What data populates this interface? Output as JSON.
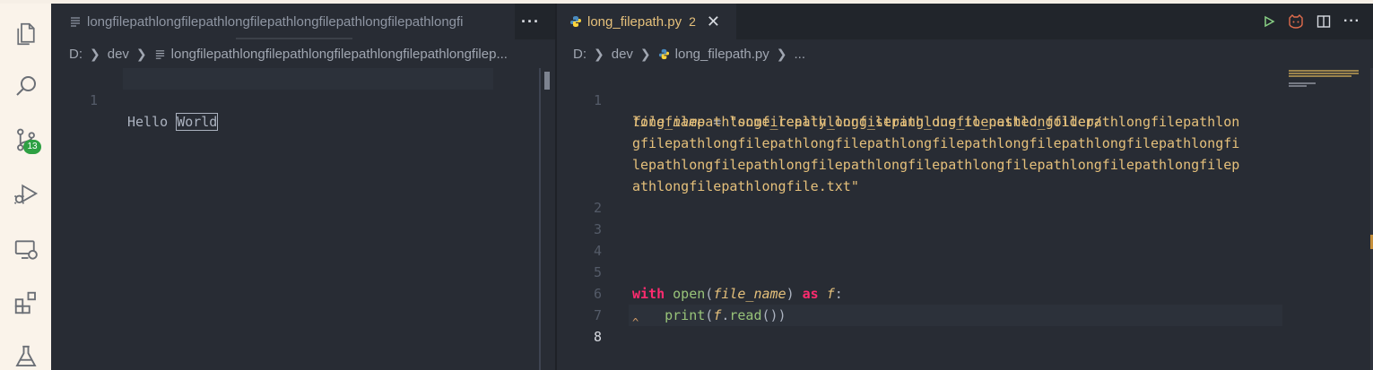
{
  "activity_bar": {
    "items": [
      {
        "name": "explorer-icon"
      },
      {
        "name": "search-icon"
      },
      {
        "name": "source-control-icon",
        "badge": "13"
      },
      {
        "name": "run-debug-icon"
      },
      {
        "name": "remote-explorer-icon"
      },
      {
        "name": "extensions-icon"
      },
      {
        "name": "testing-icon"
      }
    ]
  },
  "left_editor": {
    "tab": {
      "label": "longfilepathlongfilepathlongfilepathlongfilepathlongfilepathlongfi"
    },
    "more_label": "···",
    "breadcrumb": {
      "drive": "D:",
      "folder": "dev",
      "file": "longfilepathlongfilepathlongfilepathlongfilepathlongfilep..."
    },
    "lines": [
      {
        "number": "1",
        "before": "Hello ",
        "highlight": "World"
      }
    ]
  },
  "right_editor": {
    "tab": {
      "label": "long_filepath.py",
      "dirty_count": "2",
      "close_label": "✕"
    },
    "breadcrumb": {
      "drive": "D:",
      "folder": "dev",
      "file": "long_filepath.py",
      "more": "..."
    },
    "actions": [
      "run-icon",
      "copilot-icon",
      "split-editor-icon",
      "more-actions-icon"
    ],
    "more_label": "···",
    "code": {
      "l1_var": "file_name",
      "l1_eq": " = ",
      "l1_str_1": "\"some_really_long_string_due_to_nested_folder/",
      "l1_str_2": "longfilepathlongfilepathlongfilepathlongfilepathlongfilepathlongfilepathlon",
      "l1_str_3": "gfilepathlongfilepathlongfilepathlongfilepathlongfilepathlongfilepathlongfi",
      "l1_str_4": "lepathlongfilepathlongfilepathlongfilepathlongfilepathlongfilepathlongfilep",
      "l1_str_5": "athlongfilepathlongfile.txt\"",
      "l5_with": "with",
      "l5_open": "open",
      "l5_lp": "(",
      "l5_arg": "file_name",
      "l5_rp": ") ",
      "l5_as": "as",
      "l5_f": "f",
      "l5_colon": ":",
      "l6_indent": "    ",
      "l6_print": "print",
      "l6_lp": "(",
      "l6_f": "f",
      "l6_dot": ".",
      "l6_read": "read",
      "l6_rest": "())",
      "l8_marker": "^"
    },
    "line_numbers": [
      "1",
      "2",
      "3",
      "4",
      "5",
      "6",
      "7",
      "8"
    ],
    "active_line": "8"
  }
}
